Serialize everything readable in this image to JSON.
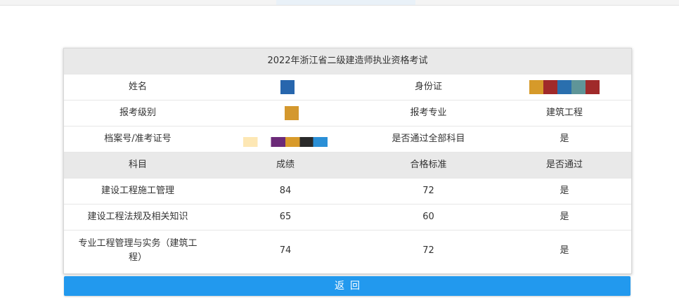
{
  "colors": {
    "header_bg": "#e9e9e9",
    "button_bg": "#2299ee",
    "button_text": "#ffffff",
    "text": "#333333"
  },
  "exam": {
    "title": "2022年浙江省二级建造师执业资格考试",
    "info": {
      "name_label": "姓名",
      "id_label": "身份证",
      "level_label": "报考级别",
      "major_label": "报考专业",
      "major_value": "建筑工程",
      "file_label": "档案号/准考证号",
      "all_passed_label": "是否通过全部科目",
      "all_passed_value": "是"
    },
    "columns": [
      "科目",
      "成绩",
      "合格标准",
      "是否通过"
    ],
    "subjects": [
      {
        "name": "建设工程施工管理",
        "score": "84",
        "standard": "72",
        "passed": "是"
      },
      {
        "name": "建设工程法规及相关知识",
        "score": "65",
        "standard": "60",
        "passed": "是"
      },
      {
        "name": "专业工程管理与实务（建筑工程）",
        "score": "74",
        "standard": "72",
        "passed": "是"
      }
    ]
  },
  "actions": {
    "back_label": "返回"
  }
}
